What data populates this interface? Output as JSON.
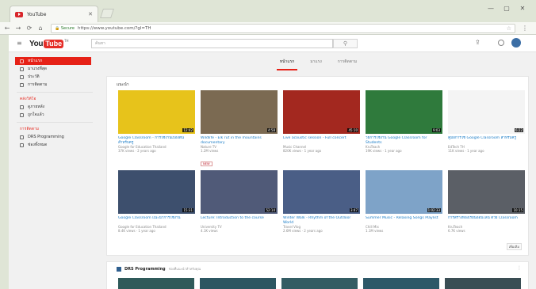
{
  "browser": {
    "tab_title": "YouTube",
    "tab_close": "✕",
    "url_secure": "🔒 Secure",
    "url": "https://www.youtube.com/?gl=TH",
    "star": "☆",
    "menu": "⋮",
    "window_min": "—",
    "window_max": "▢",
    "window_close": "✕",
    "nav_back": "←",
    "nav_forward": "→",
    "nav_reload": "⟳",
    "nav_home": "⌂"
  },
  "masthead": {
    "guide": "≡",
    "logo_you": "You",
    "logo_tube": "Tube",
    "logo_region": "TH",
    "search_placeholder": "ค้นหา",
    "search_icon": "⚲",
    "upload_icon": "⇪"
  },
  "sidebar": {
    "items": [
      {
        "label": "หน้าแรก",
        "icon": "home-icon"
      },
      {
        "label": "มาแรงที่สุด",
        "icon": "trending-icon"
      },
      {
        "label": "ประวัติ",
        "icon": "history-icon"
      },
      {
        "label": "การติดตาม",
        "icon": "subscriptions-icon"
      }
    ],
    "library_heading": "คลังวิดีโอ",
    "library_items": [
      {
        "label": "ดูภายหลัง",
        "icon": "watch-later-icon"
      },
      {
        "label": "ถูกใจแล้ว",
        "icon": "liked-icon"
      }
    ],
    "subs_heading": "การติดตาม",
    "subs_items": [
      {
        "label": "DRS Programming",
        "icon": "channel-icon"
      },
      {
        "label": "ช่องทั้งหมด",
        "icon": "browse-icon"
      }
    ]
  },
  "feed_tabs": [
    "หน้าแรก",
    "มาแรง",
    "การติดตาม"
  ],
  "shelf1": {
    "title": "แนะนำ",
    "more": "เพิ่มเติม",
    "row1": [
      {
        "title": "Google Classroom - การใช้งานเบื้องต้น สำหรับครู",
        "channel": "Google for Education Thailand",
        "meta": "37K views · 2 years ago",
        "duration": "12:42",
        "bg": "#e7c31b"
      },
      {
        "title": "Wildlife - Elk rut in the mountains documentary",
        "channel": "Nature TV",
        "meta": "1.2M views",
        "badge": "NEW",
        "duration": "4:58",
        "bg": "#7b6a52"
      },
      {
        "title": "Live acoustic session - Full concert",
        "channel": "Music Channel",
        "meta": "820K views · 1 year ago",
        "duration": "45:10",
        "bg": "#a3281f"
      },
      {
        "title": "วิธีการใช้งาน Google Classroom for Students",
        "channel": "KruTeach",
        "meta": "19K views · 1 year ago",
        "duration": "9:03",
        "bg": "#2f7a3c"
      },
      {
        "title": "คู่มือการใช้ Google Classroom สำหรับครู",
        "channel": "EdTech TH",
        "meta": "11K views · 1 year ago",
        "duration": "6:22",
        "bg": "#f4f4f4"
      }
    ],
    "row2": [
      {
        "title": "Google Classroom แนะนำการใช้งาน",
        "channel": "Google for Education Thailand",
        "meta": "8.4K views · 1 year ago",
        "duration": "15:31",
        "bg": "#3d4f6d"
      },
      {
        "title": "Lecture: Introduction to the course",
        "channel": "University TV",
        "meta": "4.1K views",
        "duration": "52:14",
        "bg": "#505a78"
      },
      {
        "title": "Winter Walk - Rhythm of the Outdoor World",
        "channel": "Travel Vlog",
        "meta": "2.6M views · 2 years ago",
        "duration": "3:47",
        "bg": "#4a5e86"
      },
      {
        "title": "Summer Music - Relaxing Songs Playlist",
        "channel": "Chill Mix",
        "meta": "1.1M views",
        "duration": "1:02:33",
        "bg": "#7ea3c8"
      },
      {
        "title": "การสร้างห้องเรียนออนไลน์ ด้วย Classroom",
        "channel": "KruTeach",
        "meta": "6.7K views",
        "duration": "10:15",
        "bg": "#5b5f66"
      }
    ]
  },
  "shelf2": {
    "title": "DRS Programming",
    "subtitle": "ช่องที่แนะนำสำหรับคุณ",
    "menu": "⋮",
    "thumbs": [
      "#2f5a5a",
      "#2c5661",
      "#335c63",
      "#2d5868",
      "#3a4e54"
    ]
  },
  "colors": {
    "accent": "#e62117",
    "link": "#167ac6"
  }
}
